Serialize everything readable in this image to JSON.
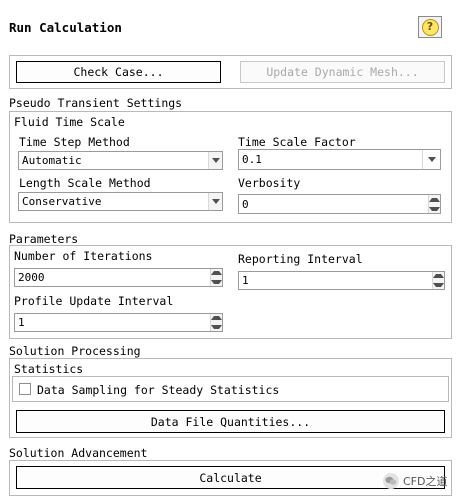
{
  "header": {
    "title": "Run Calculation",
    "help_icon": "help-icon",
    "help_glyph": "?"
  },
  "top_buttons": {
    "check_case": "Check Case...",
    "update_mesh": "Update Dynamic Mesh..."
  },
  "pseudo": {
    "section_label": "Pseudo Transient Settings",
    "fluid_group_label": "Fluid Time Scale",
    "time_step_method": {
      "label": "Time Step Method",
      "value": "Automatic"
    },
    "time_scale_factor": {
      "label": "Time Scale Factor",
      "value": "0.1"
    },
    "length_scale_method": {
      "label": "Length Scale Method",
      "value": "Conservative"
    },
    "verbosity": {
      "label": "Verbosity",
      "value": "0"
    }
  },
  "parameters": {
    "section_label": "Parameters",
    "iterations": {
      "label": "Number of Iterations",
      "value": "2000"
    },
    "reporting": {
      "label": "Reporting Interval",
      "value": "1"
    },
    "profile": {
      "label": "Profile Update Interval",
      "value": "1"
    }
  },
  "processing": {
    "section_label": "Solution Processing",
    "statistics_label": "Statistics",
    "sampling_label": "Data Sampling for Steady Statistics",
    "sampling_checked": false,
    "quantities_button": "Data File Quantities..."
  },
  "advancement": {
    "section_label": "Solution Advancement",
    "calculate_button": "Calculate"
  },
  "watermark": {
    "text": "CFD之道"
  }
}
